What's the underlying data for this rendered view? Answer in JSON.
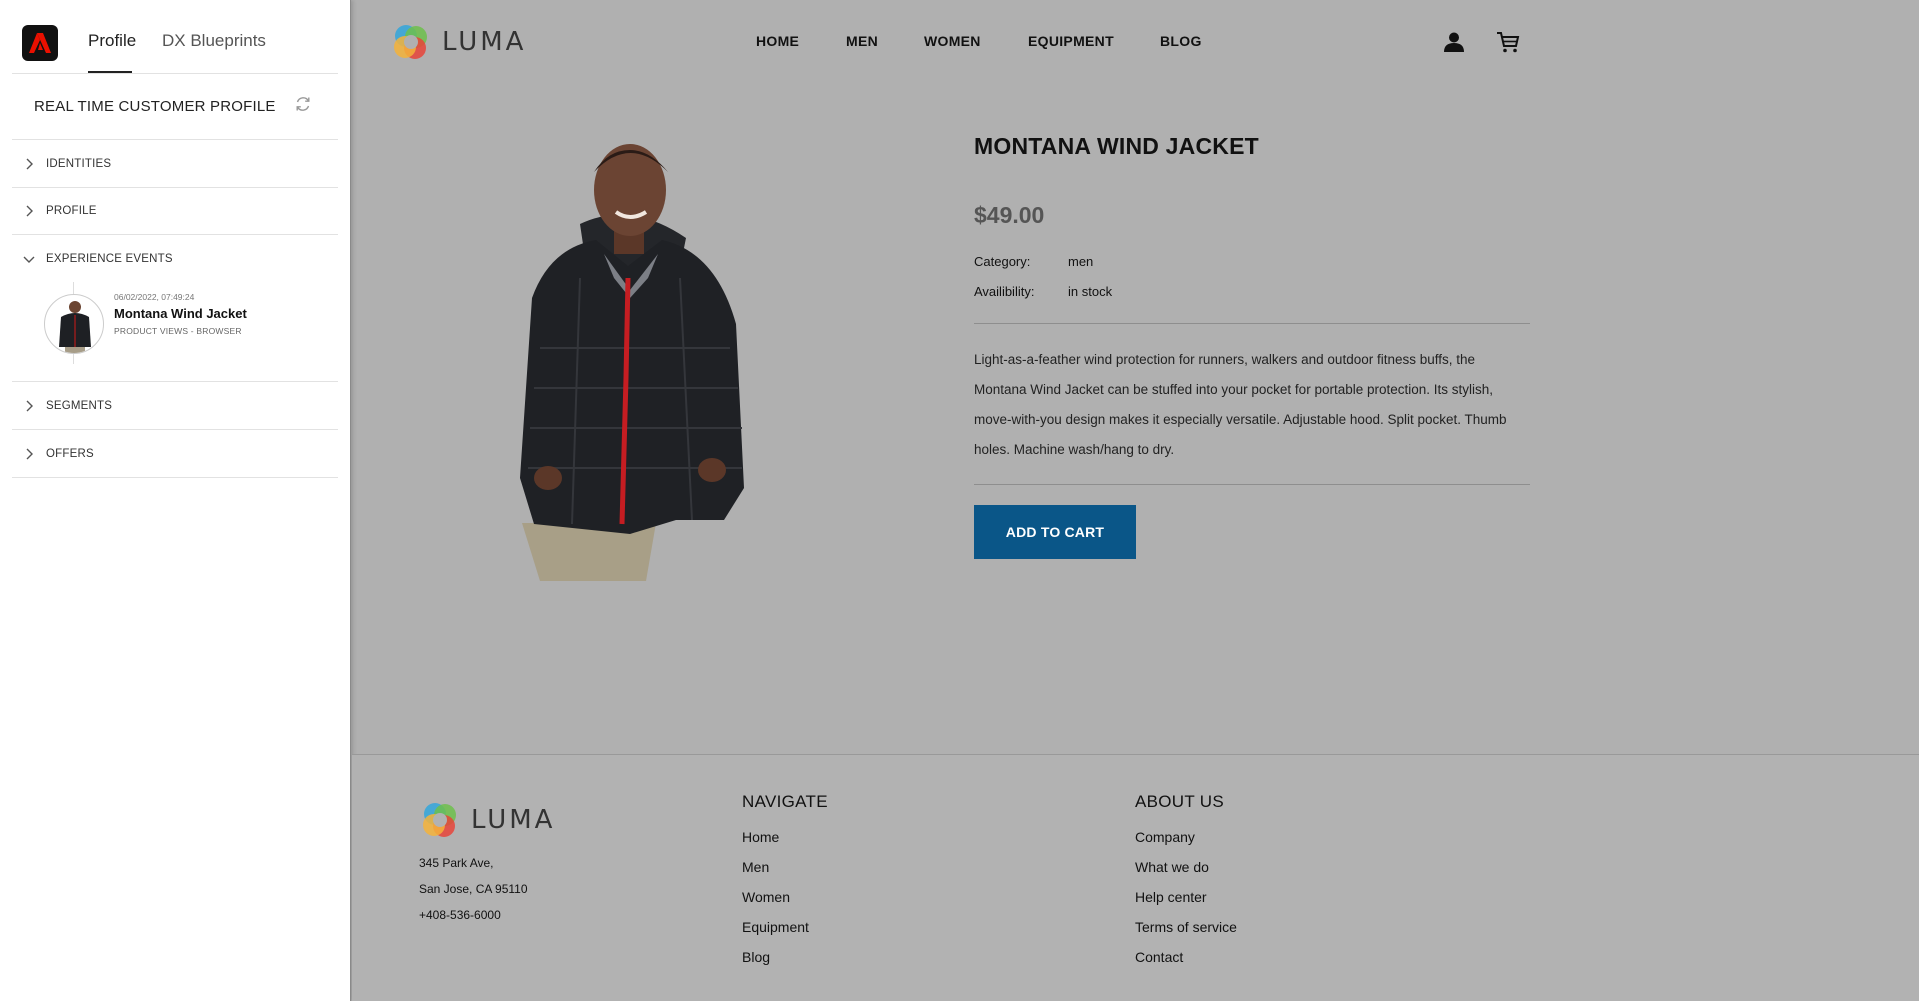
{
  "panel": {
    "tabs": [
      {
        "label": "Profile"
      },
      {
        "label": "DX Blueprints"
      }
    ],
    "title": "REAL TIME CUSTOMER PROFILE",
    "sections": {
      "identities": "IDENTITIES",
      "profile": "PROFILE",
      "experience_events": "EXPERIENCE EVENTS",
      "segments": "SEGMENTS",
      "offers": "OFFERS"
    },
    "event": {
      "timestamp": "06/02/2022, 07:49:24",
      "name": "Montana Wind Jacket",
      "source": "PRODUCT VIEWS - BROWSER"
    }
  },
  "site": {
    "brand": "LUMA",
    "nav": [
      "HOME",
      "MEN",
      "WOMEN",
      "EQUIPMENT",
      "BLOG"
    ],
    "product": {
      "title": "MONTANA WIND JACKET",
      "price": "$49.00",
      "category_label": "Category:",
      "category": "men",
      "availability_label": "Availibility:",
      "availability": "in stock",
      "description": "Light-as-a-feather wind protection for runners, walkers and outdoor fitness buffs, the Montana Wind Jacket can be stuffed into your pocket for portable protection. Its stylish, move-with-you design makes it especially versatile. Adjustable hood. Split pocket. Thumb holes. Machine wash/hang to dry.",
      "add_to_cart": "ADD TO CART"
    },
    "footer": {
      "address": [
        "345 Park Ave,",
        "San Jose, CA 95110",
        "+408-536-6000"
      ],
      "navigate_title": "NAVIGATE",
      "navigate": [
        "Home",
        "Men",
        "Women",
        "Equipment",
        "Blog"
      ],
      "about_title": "ABOUT US",
      "about": [
        "Company",
        "What we do",
        "Help center",
        "Terms of service",
        "Contact"
      ]
    }
  },
  "colors": {
    "button": "#0a5688",
    "page_bg": "#b0b0b0",
    "adobe_red": "#eb1000"
  },
  "icons": [
    "adobe-logo-icon",
    "refresh-icon",
    "chevron-right-icon",
    "chevron-down-icon",
    "luma-logo-icon",
    "user-icon",
    "cart-icon"
  ]
}
